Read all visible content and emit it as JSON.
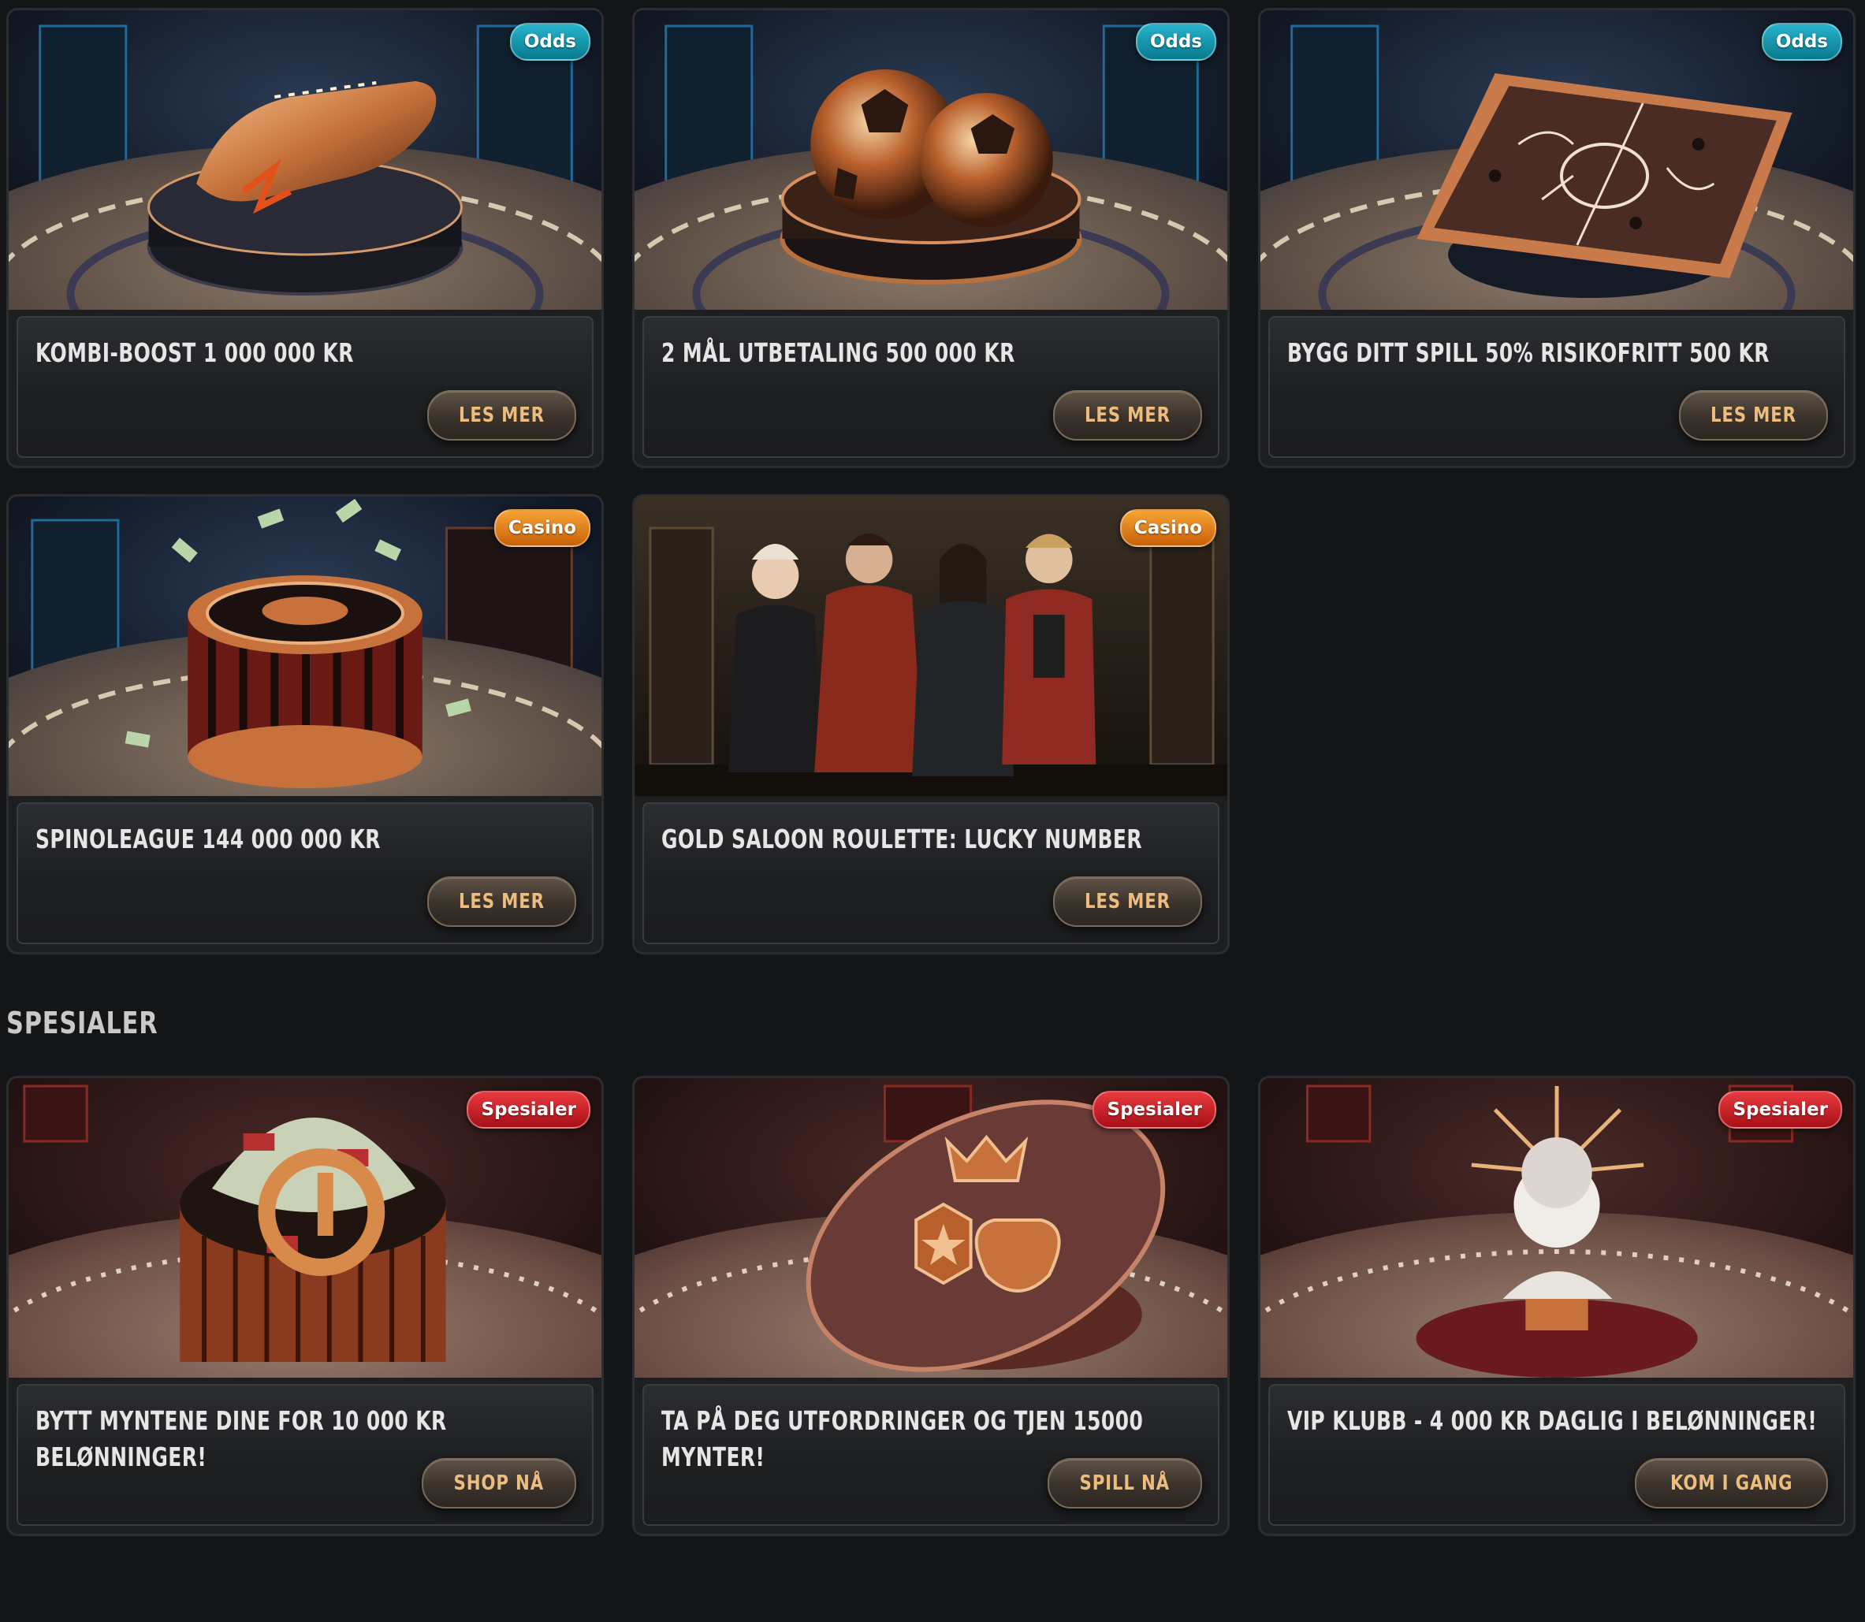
{
  "sections": [
    {
      "title": "",
      "cards": [
        {
          "badge": "Odds",
          "badge_type": "odds",
          "title": "KOMBI-BOOST 1 000 000 KR",
          "button": "LES MER",
          "image": "golden-boot-on-pedestal"
        },
        {
          "badge": "Odds",
          "badge_type": "odds",
          "title": "2 MÅL UTBETALING 500 000 KR",
          "button": "LES MER",
          "image": "copper-footballs-on-pedestal"
        },
        {
          "badge": "Odds",
          "badge_type": "odds",
          "title": "BYGG DITT SPILL 50% RISIKOFRITT 500 KR",
          "button": "LES MER",
          "image": "tactics-board-on-pedestal"
        },
        {
          "badge": "Casino",
          "badge_type": "casino",
          "title": "SPINOLEAGUE 144 000 000 KR",
          "button": "LES MER",
          "image": "roulette-wheel-with-money"
        },
        {
          "badge": "Casino",
          "badge_type": "casino",
          "title": "GOLD SALOON ROULETTE: LUCKY NUMBER",
          "button": "LES MER",
          "image": "four-characters-in-saloon"
        }
      ]
    },
    {
      "title": "SPESIALER",
      "cards": [
        {
          "badge": "Spesialer",
          "badge_type": "spesialer",
          "title": "BYTT MYNTENE DINE FOR 10 000 KR BELØNNINGER!",
          "button": "SHOP NÅ",
          "image": "money-stacks-pedestal"
        },
        {
          "badge": "Spesialer",
          "badge_type": "spesialer",
          "title": "TA PÅ DEG UTFORDRINGER OG TJEN 15000 MYNTER!",
          "button": "SPILL NÅ",
          "image": "badges-crown-trophy-pedestal"
        },
        {
          "badge": "Spesialer",
          "badge_type": "spesialer",
          "title": "VIP KLUBB - 4 000 KR DAGLIG I BELØNNINGER!",
          "button": "KOM I GANG",
          "image": "vip-bust-statue"
        }
      ]
    }
  ],
  "colors": {
    "background": "#131517",
    "button_text": "#ecbd7f",
    "odds_badge": "#1a9db3",
    "casino_badge": "#e48420",
    "spesialer_badge": "#d0242b"
  }
}
